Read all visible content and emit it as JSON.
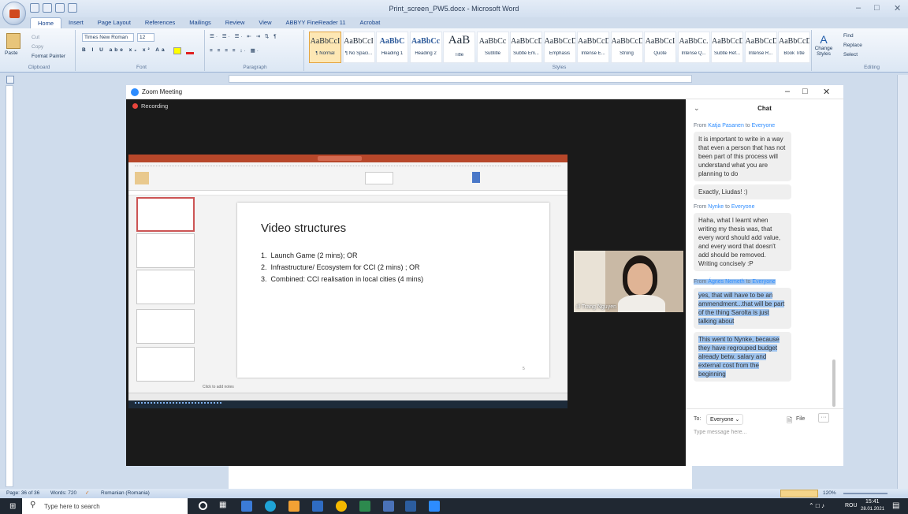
{
  "word": {
    "title": "Print_screen_PW5.docx - Microsoft Word",
    "tabs": [
      "Home",
      "Insert",
      "Page Layout",
      "References",
      "Mailings",
      "Review",
      "View",
      "ABBYY FineReader 11",
      "Acrobat"
    ],
    "clipboard": {
      "paste": "Paste",
      "cut": "Cut",
      "copy": "Copy",
      "format_painter": "Format Painter",
      "label": "Clipboard"
    },
    "font": {
      "name": "Times New Roman",
      "size": "12",
      "label": "Font"
    },
    "paragraph_label": "Paragraph",
    "styles": [
      {
        "preview": "AaBbCcI",
        "name": "¶ Normal",
        "selected": true
      },
      {
        "preview": "AaBbCcI",
        "name": "¶ No Spaci...",
        "selected": false
      },
      {
        "preview": "AaBbC",
        "name": "Heading 1",
        "selected": false
      },
      {
        "preview": "AaBbCc",
        "name": "Heading 2",
        "selected": false
      },
      {
        "preview": "AaB",
        "name": "Title",
        "selected": false
      },
      {
        "preview": "AaBbCc",
        "name": "Subtitle",
        "selected": false
      },
      {
        "preview": "AaBbCcD",
        "name": "Subtle Em...",
        "selected": false
      },
      {
        "preview": "AaBbCcD",
        "name": "Emphasis",
        "selected": false
      },
      {
        "preview": "AaBbCcD",
        "name": "Intense E...",
        "selected": false
      },
      {
        "preview": "AaBbCcD",
        "name": "Strong",
        "selected": false
      },
      {
        "preview": "AaBbCcI",
        "name": "Quote",
        "selected": false
      },
      {
        "preview": "AaBbCc.",
        "name": "Intense Q...",
        "selected": false
      },
      {
        "preview": "AaBbCcD",
        "name": "Subtle Ref...",
        "selected": false
      },
      {
        "preview": "AaBbCcD",
        "name": "Intense R...",
        "selected": false
      },
      {
        "preview": "AaBbCcD",
        "name": "Book Title",
        "selected": false
      }
    ],
    "styles_label": "Styles",
    "change_styles": "Change Styles",
    "editing": {
      "find": "Find",
      "replace": "Replace",
      "select": "Select",
      "label": "Editing"
    },
    "status": {
      "page": "Page: 36 of 36",
      "words": "Words: 720",
      "language": "Romanian (Romania)",
      "zoom": "120%"
    }
  },
  "zoom": {
    "title": "Zoom Meeting",
    "recording": "Recording",
    "participant_name": "Trang Nguyen",
    "chat_title": "Chat",
    "messages": [
      {
        "from": "Katja Pasanen",
        "to": "Everyone",
        "texts": [
          "It is important to write in a way that even a person that has not been part of this process will understand what you are planning to do",
          "Exactly, Liudas! :)"
        ],
        "highlighted": false
      },
      {
        "from": "Nynke",
        "to": "Everyone",
        "texts": [
          "Haha, what I learnt when writing my thesis was, that every word should add value, and every word that doesn't add should be removed. Writing concisely :P"
        ],
        "highlighted": false
      },
      {
        "from": "Ágnes Nemeth",
        "to": "Everyone",
        "texts": [
          "yes, that will have to be an ammendment...that will be part of the thing Sarolta is just talking about",
          "This went to Nynke, because they have regrouped budget already betw. salary and external cost from the beginning"
        ],
        "highlighted": true
      }
    ],
    "from_word": "From",
    "to_word": "to",
    "to_label": "To:",
    "to_value": "Everyone",
    "file_label": "File",
    "input_placeholder": "Type message here..."
  },
  "slide": {
    "title": "Video structures",
    "items": [
      "Launch Game (2 mins); OR",
      "Infrastructure/ Ecosystem for CCI (2 mins) ; OR",
      "Combined: CCI realisation in local cities (4 mins)"
    ],
    "page_number": "5",
    "notes_placeholder": "Click to add notes"
  },
  "taskbar": {
    "search_placeholder": "Type here to search",
    "language": "ROU",
    "time": "15:41",
    "date": "28.01.2021"
  },
  "colors": {
    "zoom_blue": "#2d8cff",
    "ppt_red": "#b7472a",
    "word_blue": "#1e395b"
  }
}
